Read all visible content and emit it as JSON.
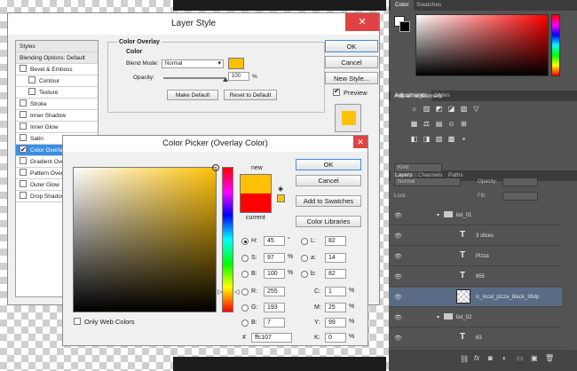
{
  "layer_style": {
    "title": "Layer Style",
    "close": "✕",
    "styles": [
      {
        "label": "Styles",
        "checkbox": false,
        "indent": false,
        "head": true
      },
      {
        "label": "Blending Options: Default",
        "checkbox": false,
        "indent": false,
        "head": true
      },
      {
        "label": "Bevel & Emboss",
        "checkbox": true,
        "checked": false,
        "indent": false
      },
      {
        "label": "Contour",
        "checkbox": true,
        "checked": false,
        "indent": true
      },
      {
        "label": "Texture",
        "checkbox": true,
        "checked": false,
        "indent": true
      },
      {
        "label": "Stroke",
        "checkbox": true,
        "checked": false,
        "indent": false
      },
      {
        "label": "Inner Shadow",
        "checkbox": true,
        "checked": false,
        "indent": false
      },
      {
        "label": "Inner Glow",
        "checkbox": true,
        "checked": false,
        "indent": false
      },
      {
        "label": "Satin",
        "checkbox": true,
        "checked": false,
        "indent": false
      },
      {
        "label": "Color Overlay",
        "checkbox": true,
        "checked": true,
        "indent": false,
        "selected": true
      },
      {
        "label": "Gradient Overlay",
        "checkbox": true,
        "checked": false,
        "indent": false
      },
      {
        "label": "Pattern Overlay",
        "checkbox": true,
        "checked": false,
        "indent": false
      },
      {
        "label": "Outer Glow",
        "checkbox": true,
        "checked": false,
        "indent": false
      },
      {
        "label": "Drop Shadow",
        "checkbox": true,
        "checked": false,
        "indent": false
      }
    ],
    "group_title": "Color Overlay",
    "sub_title": "Color",
    "blend_mode_label": "Blend Mode:",
    "blend_mode_value": "Normal",
    "opacity_label": "Opacity:",
    "opacity_value": "100",
    "opacity_unit": "%",
    "opacity_slider": 1.0,
    "make_default": "Make Default",
    "reset_default": "Reset to Default",
    "ok": "OK",
    "cancel": "Cancel",
    "new_style": "New Style...",
    "preview_label": "Preview",
    "preview_checked": true,
    "overlay_color": "#ffc107"
  },
  "color_picker": {
    "title": "Color Picker (Overlay Color)",
    "close": "✕",
    "new_label": "new",
    "current_label": "current",
    "new_color": "#ffc107",
    "current_color": "#ff0000",
    "ok": "OK",
    "cancel": "Cancel",
    "add_swatches": "Add to Swatches",
    "color_libraries": "Color Libraries",
    "only_web": "Only Web Colors",
    "fields": {
      "H": {
        "label": "H:",
        "value": "45",
        "unit": "°"
      },
      "S": {
        "label": "S:",
        "value": "97",
        "unit": "%"
      },
      "B": {
        "label": "B:",
        "value": "100",
        "unit": "%"
      },
      "R": {
        "label": "R:",
        "value": "255"
      },
      "G": {
        "label": "G:",
        "value": "193"
      },
      "Bv": {
        "label": "B:",
        "value": "7"
      },
      "L": {
        "label": "L:",
        "value": "82"
      },
      "a": {
        "label": "a:",
        "value": "14"
      },
      "b": {
        "label": "b:",
        "value": "82"
      },
      "C": {
        "label": "C:",
        "value": "1",
        "unit": "%"
      },
      "M": {
        "label": "M:",
        "value": "25",
        "unit": "%"
      },
      "Y": {
        "label": "Y:",
        "value": "99",
        "unit": "%"
      },
      "K": {
        "label": "K:",
        "value": "0",
        "unit": "%"
      },
      "hex_label": "#",
      "hex": "ffc107"
    },
    "hue_color": "#ffc107"
  },
  "ps": {
    "tabs_top": [
      "Color",
      "Swatches"
    ],
    "adjustments_tabs": [
      "Adjustments",
      "Styles"
    ],
    "add_adjustment": "Add an adjustment",
    "layers_tabs": [
      "Layers",
      "Channels",
      "Paths"
    ],
    "kind_label": "Kind",
    "blend_value": "Normal",
    "opacity_label": "Opacity:",
    "lock_label": "Lock:",
    "fill_label": "Fill:",
    "layers": [
      {
        "name": "list_01",
        "type": "group",
        "indent": 1
      },
      {
        "name": "3 slices",
        "type": "text",
        "indent": 2
      },
      {
        "name": "Pizza",
        "type": "text",
        "indent": 2
      },
      {
        "name": "855",
        "type": "text",
        "indent": 2
      },
      {
        "name": "ic_local_pizza_black_36dp",
        "type": "image",
        "indent": 2,
        "selected": true
      },
      {
        "name": "list_02",
        "type": "group",
        "indent": 1
      },
      {
        "name": "63",
        "type": "text",
        "indent": 2
      }
    ],
    "fg_color": "#ffffff",
    "bg_color": "#000000"
  }
}
